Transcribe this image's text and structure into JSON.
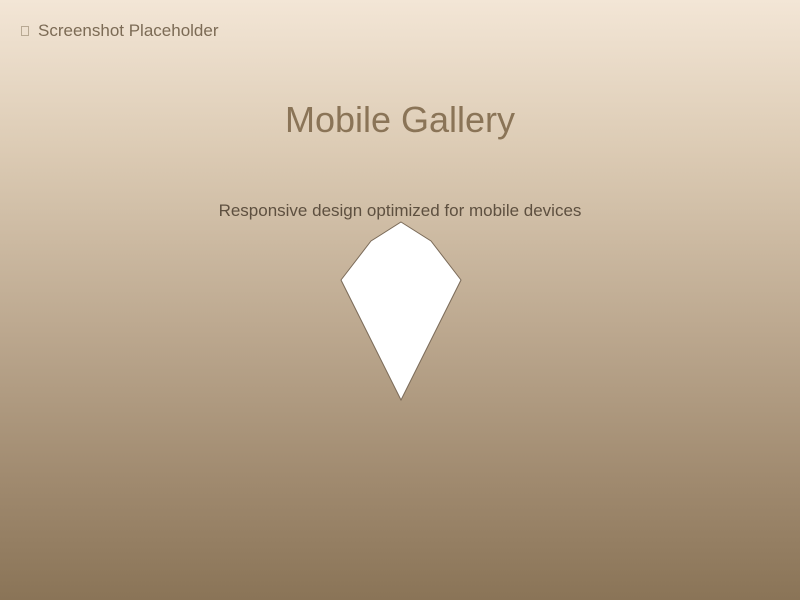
{
  "placeholder": {
    "label": "Screenshot Placeholder",
    "icon": "image-placeholder-icon"
  },
  "header": {
    "title": "Mobile Gallery",
    "subtitle": "Responsive design optimized for mobile devices"
  },
  "graphic": {
    "icon": "kite-shape-icon",
    "fill": "#ffffff",
    "stroke": "#7a6a58"
  }
}
